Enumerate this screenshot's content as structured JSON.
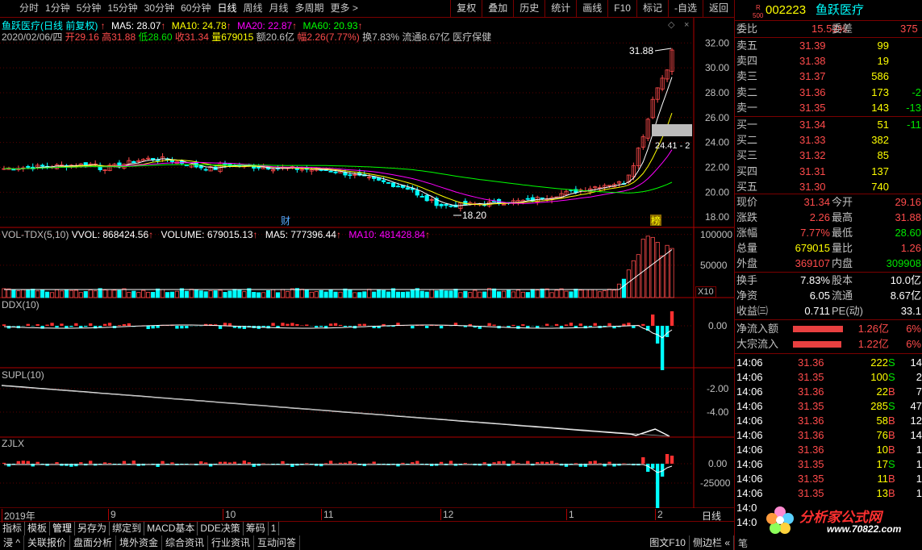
{
  "toolbar": {
    "periods": [
      "分时",
      "1分钟",
      "5分钟",
      "15分钟",
      "30分钟",
      "60分钟",
      "日线",
      "周线",
      "月线",
      "多周期",
      "更多 >"
    ],
    "active_period": "日线",
    "tools": [
      "复权",
      "叠加",
      "历史",
      "统计",
      "画线",
      "F10",
      "标记",
      "-自选",
      "返回"
    ]
  },
  "main_panel": {
    "title": "鱼跃医疗(日线 前复权)",
    "ma5": "MA5: 28.07",
    "ma10": "MA10: 24.78",
    "ma20": "MA20: 22.87",
    "ma60": "MA60: 20.93",
    "info_date": "2020/02/06/四",
    "info_open": "开29.16",
    "info_high": "高31.88",
    "info_low": "低28.60",
    "info_close": "收31.34",
    "info_vol": "量679015",
    "info_amount": "额20.6亿",
    "info_change": "幅2.26(7.77%)",
    "info_turnover": "换7.83%",
    "info_float": "流通8.67亿",
    "info_sector": "医疗保健",
    "y_ticks": [
      "32.00",
      "30.00",
      "28.00",
      "26.00",
      "24.00",
      "22.00",
      "20.00",
      "18.00"
    ],
    "high_label": "31.88",
    "low_label": "18.20",
    "cursor_label": "24.41 - 2",
    "mark_cai": "财",
    "mark_bang": "榜"
  },
  "vol_panel": {
    "title": "VOL-TDX(5,10)",
    "vvol": "VVOL: 868424.56",
    "volume": "VOLUME: 679015.13",
    "ma5": "MA5: 777396.44",
    "ma10": "MA10: 481428.84",
    "y_ticks": [
      "100000",
      "50000"
    ],
    "unit": "X10"
  },
  "ddx_panel": {
    "title": "DDX(10)",
    "y_ticks": [
      "0.00"
    ]
  },
  "supl_panel": {
    "title": "SUPL(10)",
    "y_ticks": [
      "-2.00",
      "-4.00"
    ]
  },
  "zjlx_panel": {
    "title": "ZJLX",
    "y_ticks": [
      "0.00",
      "-25000"
    ]
  },
  "x_axis": {
    "labels": [
      "2019年",
      "9",
      "10",
      "11",
      "12",
      "1",
      "2"
    ],
    "period": "日线"
  },
  "bottom_tabs": [
    "指标",
    "模板",
    "管理",
    "另存为",
    "绑定到",
    "MACD基本",
    "DDE决策",
    "筹码",
    "1"
  ],
  "status_tabs": [
    "浸 ^",
    "关联报价",
    "盘面分析",
    "境外资金",
    "综合资讯",
    "行业资讯",
    "互动问答"
  ],
  "status_right": [
    "图文F10",
    "侧边栏 «"
  ],
  "stock": {
    "code": "002223",
    "name": "鱼跃医疗",
    "badge_r": "R",
    "badge_num": "500",
    "weibi_label": "委比",
    "weibi": "15.53%",
    "weicha_label": "委差",
    "weicha": "375",
    "asks": [
      {
        "label": "卖五",
        "price": "31.39",
        "vol": "99",
        "chg": ""
      },
      {
        "label": "卖四",
        "price": "31.38",
        "vol": "19",
        "chg": ""
      },
      {
        "label": "卖三",
        "price": "31.37",
        "vol": "586",
        "chg": ""
      },
      {
        "label": "卖二",
        "price": "31.36",
        "vol": "173",
        "chg": "-2"
      },
      {
        "label": "卖一",
        "price": "31.35",
        "vol": "143",
        "chg": "-13"
      }
    ],
    "bids": [
      {
        "label": "买一",
        "price": "31.34",
        "vol": "51",
        "chg": "-11"
      },
      {
        "label": "买二",
        "price": "31.33",
        "vol": "382",
        "chg": ""
      },
      {
        "label": "买三",
        "price": "31.32",
        "vol": "85",
        "chg": ""
      },
      {
        "label": "买四",
        "price": "31.31",
        "vol": "137",
        "chg": ""
      },
      {
        "label": "买五",
        "price": "31.30",
        "vol": "740",
        "chg": ""
      }
    ],
    "quote": [
      {
        "l1": "现价",
        "v1": "31.34",
        "c1": "red",
        "l2": "今开",
        "v2": "29.16",
        "c2": "red"
      },
      {
        "l1": "涨跌",
        "v1": "2.26",
        "c1": "red",
        "l2": "最高",
        "v2": "31.88",
        "c2": "red"
      },
      {
        "l1": "涨幅",
        "v1": "7.77%",
        "c1": "red",
        "l2": "最低",
        "v2": "28.60",
        "c2": "green"
      },
      {
        "l1": "总量",
        "v1": "679015",
        "c1": "yellow",
        "l2": "量比",
        "v2": "1.26",
        "c2": "red"
      },
      {
        "l1": "外盘",
        "v1": "369107",
        "c1": "red",
        "l2": "内盘",
        "v2": "309908",
        "c2": "green"
      }
    ],
    "fundamentals": [
      {
        "l1": "换手",
        "v1": "7.83%",
        "l2": "股本",
        "v2": "10.0亿"
      },
      {
        "l1": "净资",
        "v1": "6.05",
        "l2": "流通",
        "v2": "8.67亿"
      },
      {
        "l1": "收益㈢",
        "v1": "0.711",
        "l2": "PE(动)",
        "v2": "33.1"
      }
    ],
    "flows": [
      {
        "label": "净流入额",
        "value": "1.26亿",
        "pct": "6%",
        "bar": 1.0
      },
      {
        "label": "大宗流入",
        "value": "1.22亿",
        "pct": "6%",
        "bar": 0.97
      }
    ],
    "ticks": [
      {
        "time": "14:06",
        "price": "31.36",
        "vol": "222",
        "side": "S",
        "num": "14"
      },
      {
        "time": "14:06",
        "price": "31.35",
        "vol": "100",
        "side": "S",
        "num": "2"
      },
      {
        "time": "14:06",
        "price": "31.36",
        "vol": "22",
        "side": "B",
        "num": "7"
      },
      {
        "time": "14:06",
        "price": "31.35",
        "vol": "285",
        "side": "S",
        "num": "47"
      },
      {
        "time": "14:06",
        "price": "31.36",
        "vol": "58",
        "side": "B",
        "num": "12"
      },
      {
        "time": "14:06",
        "price": "31.36",
        "vol": "76",
        "side": "B",
        "num": "14"
      },
      {
        "time": "14:06",
        "price": "31.36",
        "vol": "10",
        "side": "B",
        "num": "1"
      },
      {
        "time": "14:06",
        "price": "31.35",
        "vol": "17",
        "side": "S",
        "num": "1"
      },
      {
        "time": "14:06",
        "price": "31.35",
        "vol": "11",
        "side": "B",
        "num": "1"
      },
      {
        "time": "14:06",
        "price": "31.35",
        "vol": "13",
        "side": "B",
        "num": "1"
      },
      {
        "time": "14:0",
        "price": "",
        "vol": "",
        "side": "",
        "num": ""
      },
      {
        "time": "14:0",
        "price": "",
        "vol": "",
        "side": "",
        "num": ""
      }
    ],
    "watermark": "分析家公式网",
    "watermark_url": "www.70822.com",
    "side_label": "笔"
  },
  "colors": {
    "up": "#ff4b4b",
    "down": "#00e600",
    "grid": "#7a0000",
    "ma5": "#ffffff",
    "ma10": "#ffff00",
    "ma20": "#ff00ff",
    "ma60": "#00ff00",
    "cyan": "#00ffff"
  }
}
